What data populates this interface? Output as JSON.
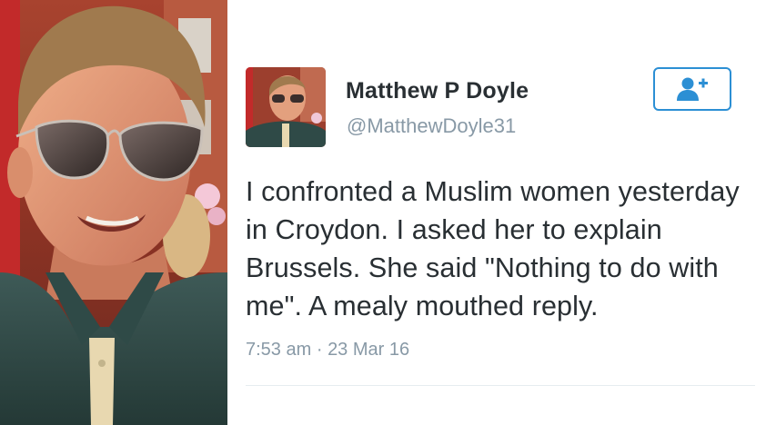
{
  "tweet": {
    "display_name": "Matthew P Doyle",
    "handle": "@MatthewDoyle31",
    "text": "I confronted a Muslim women yesterday in Croydon. I asked her to explain Brussels. She said \"Nothing to do with me\". A mealy mouthed reply.",
    "time": "7:53 am",
    "separator": "·",
    "date": "23 Mar 16"
  },
  "follow_button": {
    "icon": "add-user-icon",
    "color": "#2c8fd4"
  },
  "colors": {
    "name": "#292f33",
    "muted": "#8899a6",
    "accent": "#2c8fd4"
  }
}
